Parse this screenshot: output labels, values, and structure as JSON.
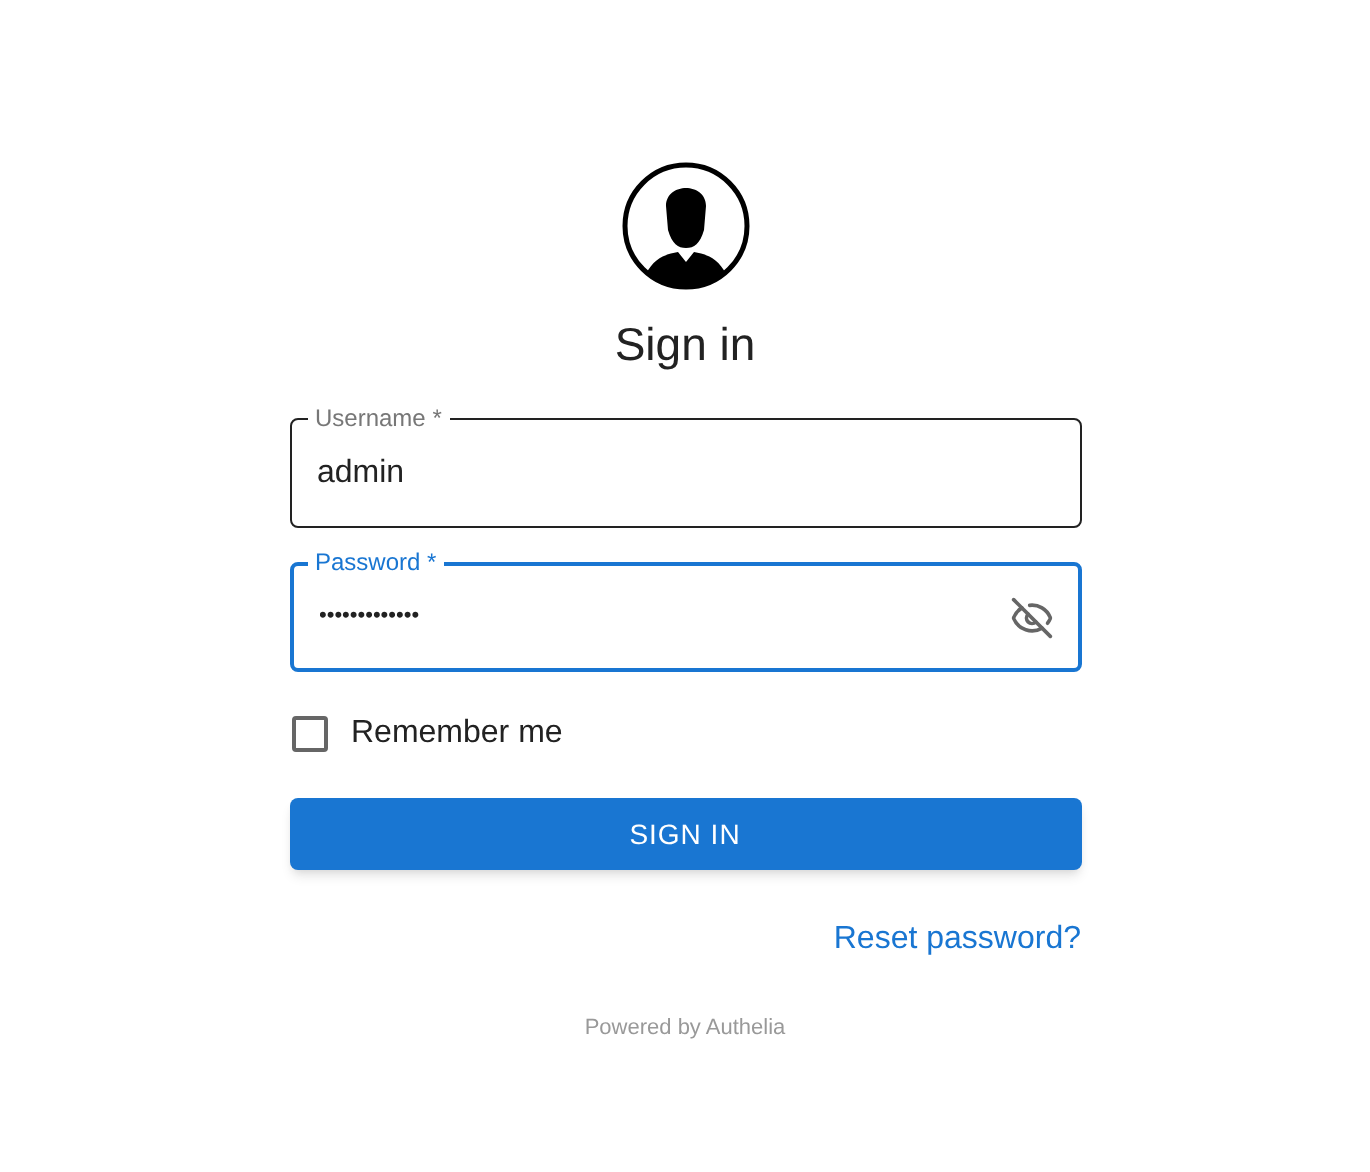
{
  "title": "Sign in",
  "fields": [
    {
      "kind": "text",
      "label": "Username *",
      "value": "admin",
      "focused": false
    },
    {
      "kind": "password",
      "label": "Password *",
      "value": "•••••••••••••",
      "focused": true
    }
  ],
  "remember": {
    "label": "Remember me",
    "checked": false
  },
  "submit": "SIGN IN",
  "reset_link": "Reset password?",
  "footer": "Powered by Authelia"
}
